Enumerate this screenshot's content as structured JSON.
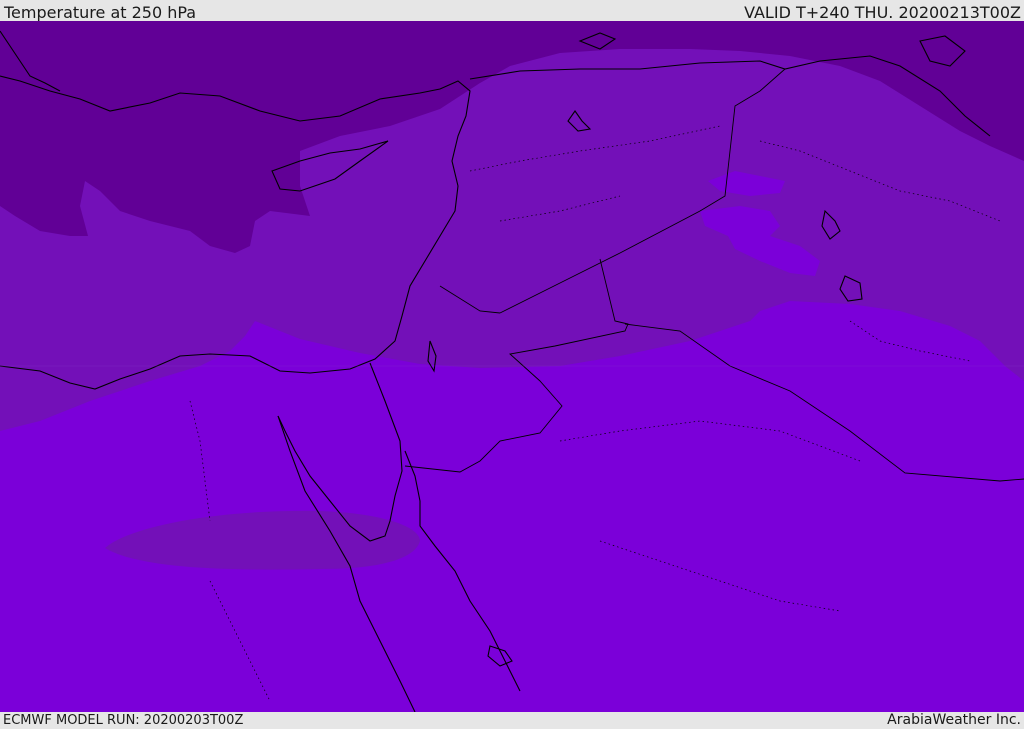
{
  "header": {
    "title": "Temperature at 250 hPa",
    "valid": "VALID T+240 THU. 20200213T00Z"
  },
  "footer": {
    "model_run": "ECMWF MODEL RUN: 20200203T00Z",
    "credit": "ArabiaWeather Inc."
  },
  "colors": {
    "coldest_band": "#610096",
    "cold_band": "#7310b8",
    "mid_band": "#7b00d9",
    "warm_patch": "#7f10ea",
    "coastline": "#000000"
  }
}
